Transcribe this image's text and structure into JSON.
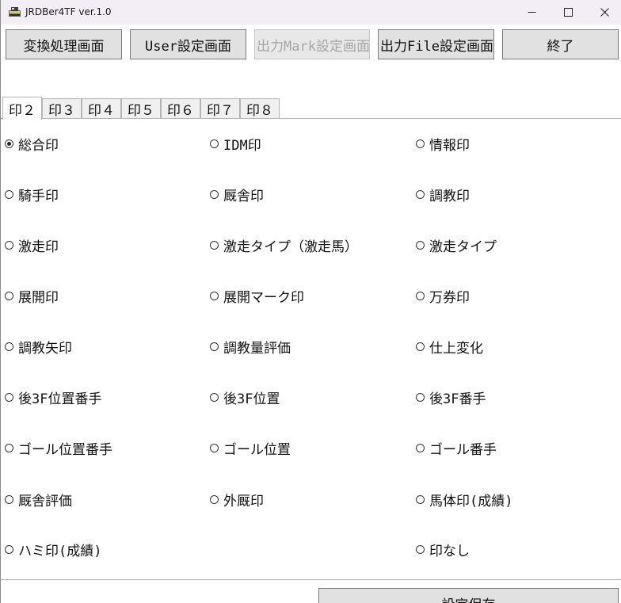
{
  "window": {
    "title": "JRDBer4TF ver.1.0"
  },
  "toolbar": {
    "convert_label": "変換処理画面",
    "user_settings_label": "User設定画面",
    "mark_settings_label": "出力Mark設定画面",
    "file_settings_label": "出力File設定画面",
    "exit_label": "終了"
  },
  "tabs": [
    {
      "label": "印２",
      "selected": true
    },
    {
      "label": "印３",
      "selected": false
    },
    {
      "label": "印４",
      "selected": false
    },
    {
      "label": "印５",
      "selected": false
    },
    {
      "label": "印６",
      "selected": false
    },
    {
      "label": "印７",
      "selected": false
    },
    {
      "label": "印８",
      "selected": false
    }
  ],
  "options": [
    {
      "label": "総合印",
      "checked": true
    },
    {
      "label": "IDM印",
      "checked": false
    },
    {
      "label": "情報印",
      "checked": false
    },
    {
      "label": "騎手印",
      "checked": false
    },
    {
      "label": "厩舎印",
      "checked": false
    },
    {
      "label": "調教印",
      "checked": false
    },
    {
      "label": "激走印",
      "checked": false
    },
    {
      "label": "激走タイプ（激走馬）",
      "checked": false
    },
    {
      "label": "激走タイプ",
      "checked": false
    },
    {
      "label": "展開印",
      "checked": false
    },
    {
      "label": "展開マーク印",
      "checked": false
    },
    {
      "label": "万券印",
      "checked": false
    },
    {
      "label": "調教矢印",
      "checked": false
    },
    {
      "label": "調教量評価",
      "checked": false
    },
    {
      "label": "仕上変化",
      "checked": false
    },
    {
      "label": "後3F位置番手",
      "checked": false
    },
    {
      "label": "後3F位置",
      "checked": false
    },
    {
      "label": "後3F番手",
      "checked": false
    },
    {
      "label": "ゴール位置番手",
      "checked": false
    },
    {
      "label": "ゴール位置",
      "checked": false
    },
    {
      "label": "ゴール番手",
      "checked": false
    },
    {
      "label": "厩舎評価",
      "checked": false
    },
    {
      "label": "外厩印",
      "checked": false
    },
    {
      "label": "馬体印(成績)",
      "checked": false
    },
    {
      "label": "ハミ印(成績)",
      "checked": false
    },
    {
      "label": "印なし",
      "checked": false
    }
  ],
  "footer": {
    "save_label": "設定保存"
  }
}
